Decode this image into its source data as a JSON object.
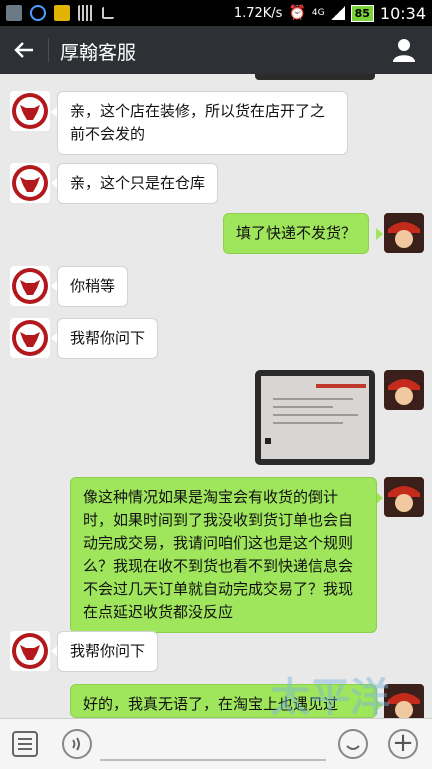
{
  "status_bar": {
    "net_speed": "1.72K/s",
    "signal_type": "4G",
    "battery": "85",
    "time": "10:34"
  },
  "app_bar": {
    "title": "厚翰客服",
    "back_icon": "arrow-left-icon",
    "profile_icon": "person-icon"
  },
  "messages": [
    {
      "side": "left",
      "text": "亲，这个店在装修，所以货在店开了之前不会发的"
    },
    {
      "side": "left",
      "text": "亲，这个只是在仓库"
    },
    {
      "side": "right",
      "text": "填了快递不发货？"
    },
    {
      "side": "left",
      "text": "你稍等"
    },
    {
      "side": "left",
      "text": "我帮你问下"
    },
    {
      "side": "right",
      "type": "image"
    },
    {
      "side": "right",
      "text": "像这种情况如果是淘宝会有收货的倒计时，如果时间到了我没收到货订单也会自动完成交易，我请问咱们这也是这个规则么？我现在收不到货也看不到快递信息会不会过几天订单就自动完成交易了？我现在点延迟收货都没反应"
    },
    {
      "side": "left",
      "text": "我帮你问下"
    },
    {
      "side": "right",
      "text": "好的，我真无语了，在淘宝上也遇见过"
    }
  ],
  "input_bar": {
    "keyboard_icon": "menu-icon",
    "voice_icon": "voice-icon",
    "emoji_icon": "emoji-icon",
    "plus_icon": "plus-icon",
    "plus_label": "+"
  },
  "watermark": {
    "text": "太平洋",
    "url": "www.pcwaishe.cn"
  },
  "colors": {
    "app_bar": "#2d3135",
    "bubble_right": "#9fe65c",
    "bubble_left": "#ffffff",
    "background": "#e9e9e9"
  }
}
